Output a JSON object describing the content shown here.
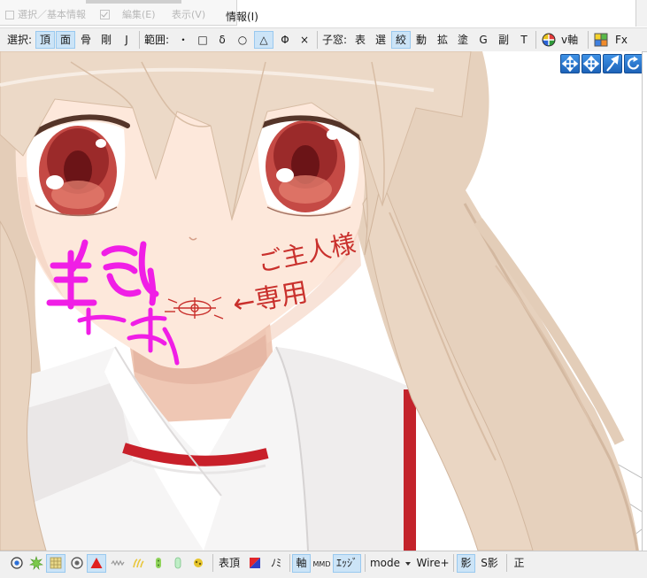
{
  "menu": {
    "faded_items": [
      "選択／基本情報",
      "編集(E)",
      "表示(V)"
    ],
    "info": "情報(I)"
  },
  "toolbar": {
    "select_label": "選択:",
    "select": [
      {
        "label": "頂",
        "active": true
      },
      {
        "label": "面",
        "active": true
      },
      {
        "label": "骨",
        "active": false
      },
      {
        "label": "剛",
        "active": false
      },
      {
        "label": "J",
        "active": false
      }
    ],
    "range_label": "範囲:",
    "range": [
      {
        "label": "・",
        "active": false
      },
      {
        "label": "□",
        "active": false
      },
      {
        "label": "δ",
        "active": false
      },
      {
        "label": "○",
        "active": false
      },
      {
        "label": "△",
        "active": true
      },
      {
        "label": "Φ",
        "active": false
      },
      {
        "label": "×",
        "active": false
      }
    ],
    "subwindow_label": "子窓:",
    "subwindow": [
      {
        "label": "表",
        "active": false
      },
      {
        "label": "選",
        "active": false
      },
      {
        "label": "絞",
        "active": true
      },
      {
        "label": "動",
        "active": false
      },
      {
        "label": "拡",
        "active": false
      },
      {
        "label": "塗",
        "active": false
      },
      {
        "label": "G",
        "active": false
      },
      {
        "label": "副",
        "active": false
      },
      {
        "label": "T",
        "active": false
      }
    ],
    "axis_icon": "color-wheel-icon",
    "axis_label": "v軸",
    "fx_icon": "color-grid-icon",
    "fx_label": "Fx"
  },
  "viewport": {
    "overlay_icons": [
      "move-plane-icon",
      "move-all-icon",
      "direction-arrow-icon",
      "rotate-icon"
    ],
    "drawing_text": {
      "line1": "ご主人様",
      "line2": "←専用"
    },
    "colors": {
      "skin": "#fde8db",
      "hair": "#ead6c3",
      "iris": "#c54a45",
      "marker_red": "#c9302c",
      "marker_magenta": "#f01ee6",
      "uniform_red": "#c8202a",
      "overlay_blue": "#2f7fd6"
    }
  },
  "bottom_toolbar": {
    "icons": [
      {
        "name": "vertex-point-icon",
        "active": false
      },
      {
        "name": "burst-icon",
        "active": false
      },
      {
        "name": "grid-icon",
        "active": true
      },
      {
        "name": "target-icon",
        "active": false
      },
      {
        "name": "red-triangle-icon",
        "active": true
      },
      {
        "name": "wave-icon",
        "active": false
      },
      {
        "name": "yellow-marks-icon",
        "active": false
      },
      {
        "name": "green-bean-icon",
        "active": false
      },
      {
        "name": "green-capsule-icon",
        "active": false
      },
      {
        "name": "yellow-dots-icon",
        "active": false
      }
    ],
    "surface_label": "表頂",
    "color_square_icon": "red-blue-square-icon",
    "nomi_label": "ﾉﾐ",
    "axis": {
      "label": "軸",
      "active": true
    },
    "mmd_icon_text": "MMD",
    "edge": {
      "label": "ｴｯｼﾞ",
      "active": true
    },
    "mode_label": "mode",
    "wire_label": "Wire+",
    "shadow": {
      "label": "影",
      "active": true
    },
    "self_shadow_label": "S影",
    "front_label": "正"
  }
}
